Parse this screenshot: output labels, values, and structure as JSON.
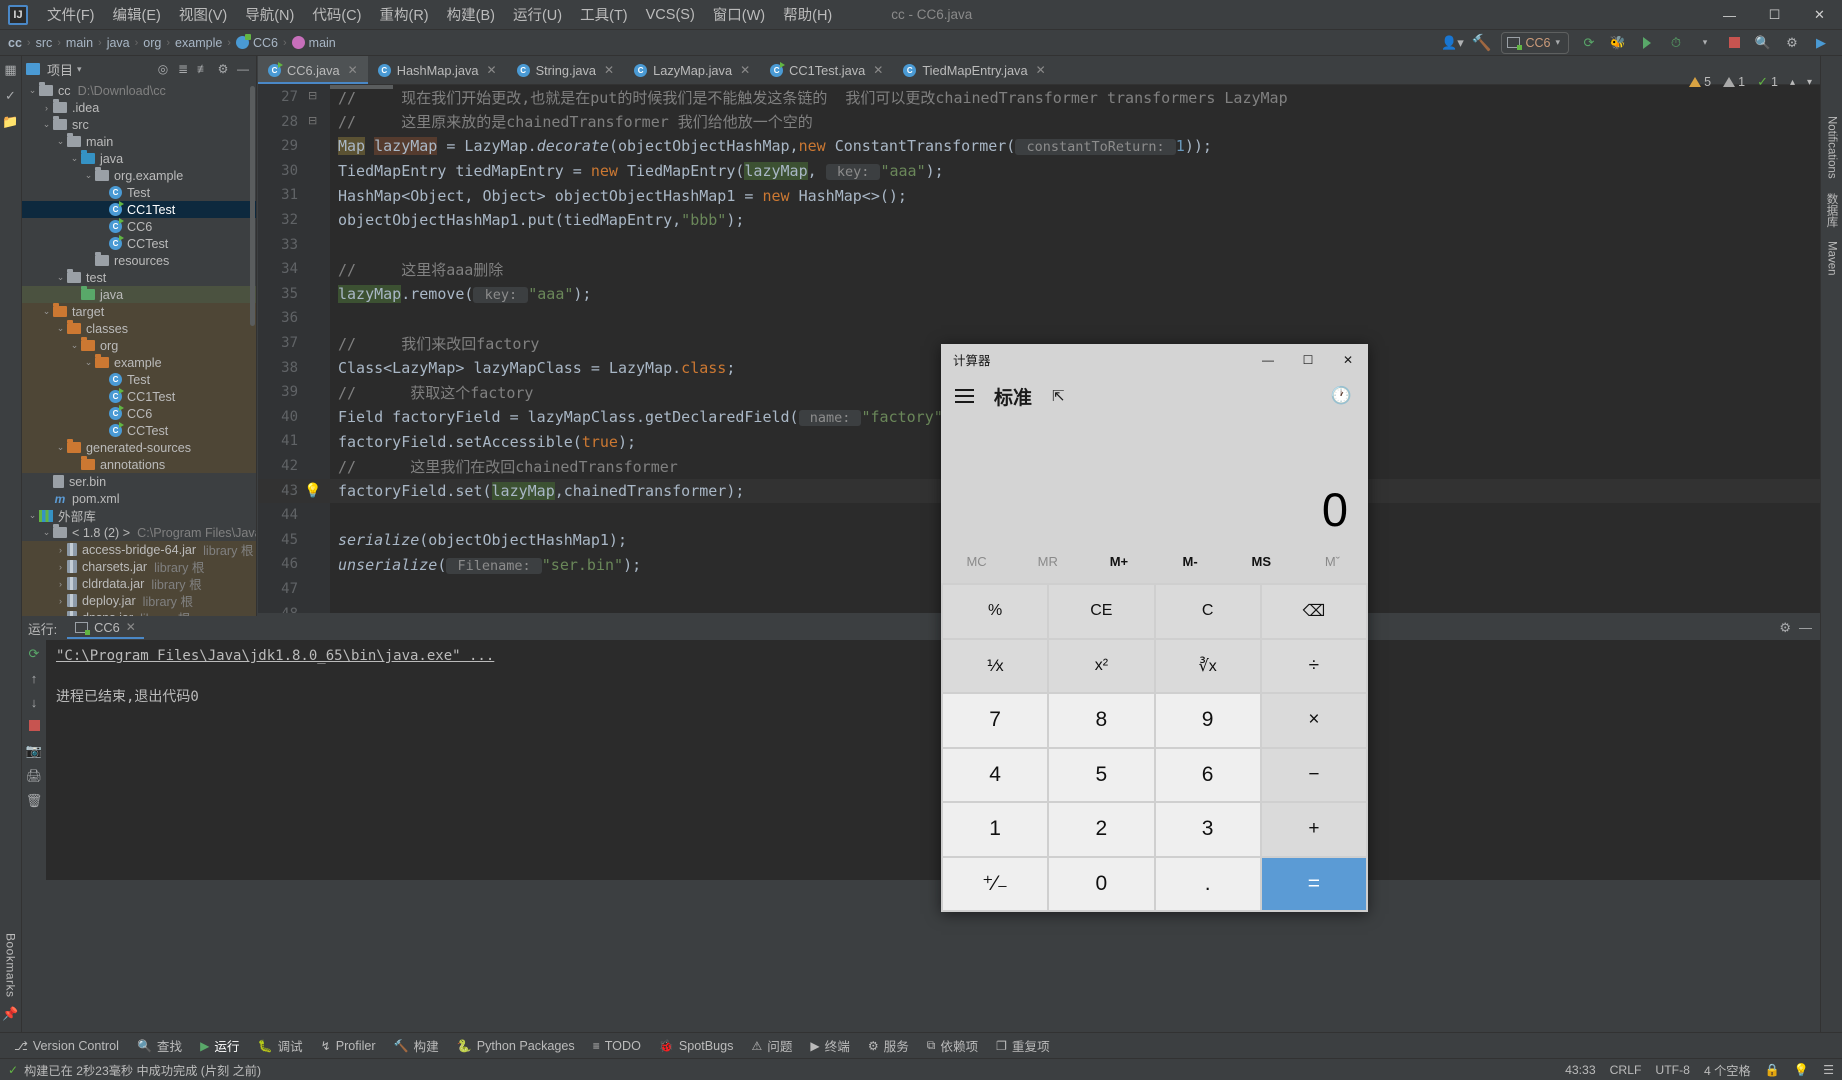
{
  "window": {
    "title": "cc - CC6.java",
    "app_logo": "IJ",
    "controls": {
      "minimize": "—",
      "maximize": "☐",
      "close": "✕"
    }
  },
  "menubar": {
    "items": [
      {
        "label": "文件(F)"
      },
      {
        "label": "编辑(E)"
      },
      {
        "label": "视图(V)"
      },
      {
        "label": "导航(N)"
      },
      {
        "label": "代码(C)"
      },
      {
        "label": "重构(R)"
      },
      {
        "label": "构建(B)"
      },
      {
        "label": "运行(U)"
      },
      {
        "label": "工具(T)"
      },
      {
        "label": "VCS(S)"
      },
      {
        "label": "窗口(W)"
      },
      {
        "label": "帮助(H)"
      }
    ]
  },
  "breadcrumb": {
    "items": [
      "cc",
      "src",
      "main",
      "java",
      "org",
      "example",
      "CC6",
      "main"
    ]
  },
  "toolbar": {
    "run_config": "CC6",
    "icons": [
      "user-icon",
      "build-hammer-icon",
      "rerun-icon",
      "debug-icon",
      "run-with-coverage-icon",
      "profile-icon",
      "stop-icon",
      "search-icon",
      "settings-icon",
      "updates-icon"
    ]
  },
  "left_rail": {
    "top_icons": [
      "project-structure-icon",
      "commit-icon",
      "folder-icon"
    ],
    "bookmarks_label": "Bookmarks"
  },
  "right_rail": {
    "labels": [
      "Notifications",
      "数据库",
      "Maven"
    ]
  },
  "project_panel": {
    "title": "项目",
    "header_icons": [
      "locate-icon",
      "expand-all-icon",
      "collapse-all-icon",
      "gear-icon",
      "hide-icon"
    ],
    "tree": [
      {
        "depth": 0,
        "arrow": "v",
        "icon": "folder-module",
        "label": "cc",
        "sub": "D:\\Download\\cc",
        "state": "normal"
      },
      {
        "depth": 1,
        "arrow": ">",
        "icon": "folder-gray",
        "label": ".idea",
        "sub": "",
        "state": "normal"
      },
      {
        "depth": 1,
        "arrow": "v",
        "icon": "folder-gray",
        "label": "src",
        "sub": "",
        "state": "normal"
      },
      {
        "depth": 2,
        "arrow": "v",
        "icon": "folder-gray",
        "label": "main",
        "sub": "",
        "state": "normal"
      },
      {
        "depth": 3,
        "arrow": "v",
        "icon": "folder-blue",
        "label": "java",
        "sub": "",
        "state": "normal"
      },
      {
        "depth": 4,
        "arrow": "v",
        "icon": "folder-package",
        "label": "org.example",
        "sub": "",
        "state": "normal"
      },
      {
        "depth": 5,
        "arrow": "",
        "icon": "class",
        "label": "Test",
        "sub": "",
        "state": "normal"
      },
      {
        "depth": 5,
        "arrow": "",
        "icon": "class-run",
        "label": "CC1Test",
        "sub": "",
        "state": "selected"
      },
      {
        "depth": 5,
        "arrow": "",
        "icon": "class-run",
        "label": "CC6",
        "sub": "",
        "state": "normal"
      },
      {
        "depth": 5,
        "arrow": "",
        "icon": "class-run",
        "label": "CCTest",
        "sub": "",
        "state": "normal"
      },
      {
        "depth": 4,
        "arrow": "",
        "icon": "folder-res",
        "label": "resources",
        "sub": "",
        "state": "normal"
      },
      {
        "depth": 2,
        "arrow": "v",
        "icon": "folder-gray",
        "label": "test",
        "sub": "",
        "state": "normal"
      },
      {
        "depth": 3,
        "arrow": "",
        "icon": "folder-green",
        "label": "java",
        "sub": "",
        "state": "green"
      },
      {
        "depth": 1,
        "arrow": "v",
        "icon": "folder-orange",
        "label": "target",
        "sub": "",
        "state": "brown"
      },
      {
        "depth": 2,
        "arrow": "v",
        "icon": "folder-orange",
        "label": "classes",
        "sub": "",
        "state": "brown"
      },
      {
        "depth": 3,
        "arrow": "v",
        "icon": "folder-orange",
        "label": "org",
        "sub": "",
        "state": "brown"
      },
      {
        "depth": 4,
        "arrow": "v",
        "icon": "folder-orange",
        "label": "example",
        "sub": "",
        "state": "brown"
      },
      {
        "depth": 5,
        "arrow": "",
        "icon": "class",
        "label": "Test",
        "sub": "",
        "state": "brown"
      },
      {
        "depth": 5,
        "arrow": "",
        "icon": "class-run",
        "label": "CC1Test",
        "sub": "",
        "state": "brown"
      },
      {
        "depth": 5,
        "arrow": "",
        "icon": "class-run",
        "label": "CC6",
        "sub": "",
        "state": "brown"
      },
      {
        "depth": 5,
        "arrow": "",
        "icon": "class-run",
        "label": "CCTest",
        "sub": "",
        "state": "brown"
      },
      {
        "depth": 2,
        "arrow": "v",
        "icon": "folder-orange",
        "label": "generated-sources",
        "sub": "",
        "state": "brown"
      },
      {
        "depth": 3,
        "arrow": "",
        "icon": "folder-orange",
        "label": "annotations",
        "sub": "",
        "state": "brown"
      },
      {
        "depth": 1,
        "arrow": "",
        "icon": "file-bin",
        "label": "ser.bin",
        "sub": "",
        "state": "normal"
      },
      {
        "depth": 1,
        "arrow": "",
        "icon": "maven",
        "label": "pom.xml",
        "sub": "",
        "state": "normal"
      },
      {
        "depth": 0,
        "arrow": "v",
        "icon": "library",
        "label": "外部库",
        "sub": "",
        "state": "normal"
      },
      {
        "depth": 1,
        "arrow": "v",
        "icon": "folder-sdk",
        "label": "< 1.8 (2) >",
        "sub": "C:\\Program Files\\Java\\jdk",
        "state": "normal"
      },
      {
        "depth": 2,
        "arrow": ">",
        "icon": "jar",
        "label": "access-bridge-64.jar",
        "sub": "library 根",
        "state": "brown"
      },
      {
        "depth": 2,
        "arrow": ">",
        "icon": "jar",
        "label": "charsets.jar",
        "sub": "library 根",
        "state": "brown"
      },
      {
        "depth": 2,
        "arrow": ">",
        "icon": "jar",
        "label": "cldrdata.jar",
        "sub": "library 根",
        "state": "brown"
      },
      {
        "depth": 2,
        "arrow": ">",
        "icon": "jar",
        "label": "deploy.jar",
        "sub": "library 根",
        "state": "brown"
      },
      {
        "depth": 2,
        "arrow": ">",
        "icon": "jar",
        "label": "dnsns.jar",
        "sub": "library 根",
        "state": "brown"
      }
    ]
  },
  "editor_tabs": [
    {
      "label": "CC6.java",
      "icon": "class-run",
      "active": true
    },
    {
      "label": "HashMap.java",
      "icon": "class",
      "active": false
    },
    {
      "label": "String.java",
      "icon": "class",
      "active": false
    },
    {
      "label": "LazyMap.java",
      "icon": "class",
      "active": false
    },
    {
      "label": "CC1Test.java",
      "icon": "class-run",
      "active": false
    },
    {
      "label": "TiedMapEntry.java",
      "icon": "class",
      "active": false
    }
  ],
  "inspection": {
    "warnings": "5",
    "weak_warnings": "1",
    "typos": "1"
  },
  "editor": {
    "first_line_number": 27,
    "lines": [
      {
        "n": 27,
        "fold": true,
        "html": "<span class=\"cmt\">//     现在我们开始更改,也就是在put的时候我们是不能触发这条链的  我们可以更改chainedTransformer transformers LazyMap</span>"
      },
      {
        "n": 28,
        "fold": true,
        "html": "<span class=\"cmt\">//     这里原来放的是chainedTransformer 我们给他放一个空的</span>"
      },
      {
        "n": 29,
        "fold": false,
        "html": "<span class=\"hl-a\">Map</span> <span class=\"hl-b\">lazyMap</span> = LazyMap.<span class=\"fn\">decorate</span>(objectObjectHashMap,<span class=\"kw\">new</span> ConstantTransformer(<span class=\"hint\"> constantToReturn: </span><span class=\"num\">1</span>));"
      },
      {
        "n": 30,
        "fold": false,
        "html": "TiedMapEntry tiedMapEntry = <span class=\"kw\">new</span> TiedMapEntry(<span class=\"hl-c\">lazyMap</span>, <span class=\"hint\"> key: </span><span class=\"str\">\"aaa\"</span>);"
      },
      {
        "n": 31,
        "fold": false,
        "html": "HashMap&lt;Object, Object&gt; objectObjectHashMap1 = <span class=\"kw\">new</span> HashMap&lt;&gt;();"
      },
      {
        "n": 32,
        "fold": false,
        "html": "objectObjectHashMap1.put(tiedMapEntry,<span class=\"str\">\"bbb\"</span>);"
      },
      {
        "n": 33,
        "fold": false,
        "html": ""
      },
      {
        "n": 34,
        "fold": false,
        "html": "<span class=\"cmt\">//     这里将aaa删除</span>"
      },
      {
        "n": 35,
        "fold": false,
        "html": "<span class=\"hl-c\">lazyMap</span>.remove(<span class=\"hint\"> key: </span><span class=\"str\">\"aaa\"</span>);"
      },
      {
        "n": 36,
        "fold": false,
        "html": ""
      },
      {
        "n": 37,
        "fold": false,
        "html": "<span class=\"cmt\">//     我们来改回factory</span>"
      },
      {
        "n": 38,
        "fold": false,
        "html": "Class&lt;LazyMap&gt; lazyMapClass = LazyMap.<span class=\"kw\">class</span>;"
      },
      {
        "n": 39,
        "fold": false,
        "html": "<span class=\"cmt\">//      获取这个factory</span>"
      },
      {
        "n": 40,
        "fold": false,
        "html": "Field factoryField = lazyMapClass.getDeclaredField(<span class=\"hint\"> name: </span><span class=\"str\">\"factory\"</span>);"
      },
      {
        "n": 41,
        "fold": false,
        "html": "factoryField.setAccessible(<span class=\"kw\">true</span>);"
      },
      {
        "n": 42,
        "fold": false,
        "html": "<span class=\"cmt\">//      这里我们在改回chainedTransformer</span>"
      },
      {
        "n": 43,
        "fold": false,
        "bulb": true,
        "current": true,
        "html": "factoryField.set(<span class=\"hl-c\">lazyMap</span>,chainedTransformer);"
      },
      {
        "n": 44,
        "fold": false,
        "html": ""
      },
      {
        "n": 45,
        "fold": false,
        "html": "<span class=\"fn\">serialize</span>(objectObjectHashMap1);"
      },
      {
        "n": 46,
        "fold": false,
        "html": "<span class=\"fn\">unserialize</span>(<span class=\"hint\"> Filename: </span><span class=\"str\">\"ser.bin\"</span>);"
      },
      {
        "n": 47,
        "fold": false,
        "html": ""
      },
      {
        "n": 48,
        "fold": false,
        "html": ""
      }
    ]
  },
  "run_panel": {
    "label": "运行:",
    "tab_label": "CC6",
    "console": [
      "\"C:\\Program Files\\Java\\jdk1.8.0_65\\bin\\java.exe\" ...",
      "进程已结束,退出代码0"
    ],
    "side_icons": [
      "rerun-icon",
      "up-icon",
      "down-icon",
      "stop-icon",
      "camera-icon",
      "print-icon",
      "trash-icon",
      "wrench-icon",
      "scroll-down-icon"
    ]
  },
  "bottom_bar": {
    "items": [
      {
        "label": "Version Control",
        "icon": "branch-icon"
      },
      {
        "label": "查找",
        "icon": "search-icon"
      },
      {
        "label": "运行",
        "icon": "run-icon",
        "active": true
      },
      {
        "label": "调试",
        "icon": "debug-icon"
      },
      {
        "label": "Profiler",
        "icon": "profiler-icon"
      },
      {
        "label": "构建",
        "icon": "build-icon"
      },
      {
        "label": "Python Packages",
        "icon": "python-icon"
      },
      {
        "label": "TODO",
        "icon": "todo-icon"
      },
      {
        "label": "SpotBugs",
        "icon": "spotbugs-icon"
      },
      {
        "label": "问题",
        "icon": "problems-icon"
      },
      {
        "label": "终端",
        "icon": "terminal-icon"
      },
      {
        "label": "服务",
        "icon": "services-icon"
      },
      {
        "label": "依赖项",
        "icon": "dependencies-icon"
      },
      {
        "label": "重复项",
        "icon": "duplicates-icon"
      }
    ]
  },
  "status_bar": {
    "message": "构建已在 2秒23毫秒 中成功完成 (片刻 之前)",
    "caret": "43:33",
    "line_sep": "CRLF",
    "encoding": "UTF-8",
    "indent": "4 个空格",
    "icons": [
      "lock-icon",
      "inspection-icon",
      "memory-icon"
    ]
  },
  "calculator": {
    "title": "计算器",
    "mode": "标准",
    "display_value": "0",
    "hamburger": "menu-icon",
    "pin": "keep-on-top-icon",
    "history": "history-icon",
    "controls": {
      "minimize": "—",
      "maximize": "☐",
      "close": "✕"
    },
    "memory_buttons": [
      {
        "label": "MC",
        "enabled": false
      },
      {
        "label": "MR",
        "enabled": false
      },
      {
        "label": "M+",
        "enabled": true
      },
      {
        "label": "M-",
        "enabled": true
      },
      {
        "label": "MS",
        "enabled": true
      },
      {
        "label": "Mˇ",
        "enabled": false
      }
    ],
    "keys": [
      {
        "label": "%",
        "type": "func"
      },
      {
        "label": "CE",
        "type": "func"
      },
      {
        "label": "C",
        "type": "func"
      },
      {
        "label": "⌫",
        "type": "func"
      },
      {
        "label": "⅟x",
        "type": "func"
      },
      {
        "label": "x²",
        "type": "func"
      },
      {
        "label": "∛x",
        "type": "func"
      },
      {
        "label": "÷",
        "type": "op"
      },
      {
        "label": "7",
        "type": "num"
      },
      {
        "label": "8",
        "type": "num"
      },
      {
        "label": "9",
        "type": "num"
      },
      {
        "label": "×",
        "type": "op"
      },
      {
        "label": "4",
        "type": "num"
      },
      {
        "label": "5",
        "type": "num"
      },
      {
        "label": "6",
        "type": "num"
      },
      {
        "label": "−",
        "type": "op"
      },
      {
        "label": "1",
        "type": "num"
      },
      {
        "label": "2",
        "type": "num"
      },
      {
        "label": "3",
        "type": "num"
      },
      {
        "label": "+",
        "type": "op"
      },
      {
        "label": "⁺⁄₋",
        "type": "num"
      },
      {
        "label": "0",
        "type": "num"
      },
      {
        "label": ".",
        "type": "num"
      },
      {
        "label": "=",
        "type": "equals"
      }
    ]
  }
}
